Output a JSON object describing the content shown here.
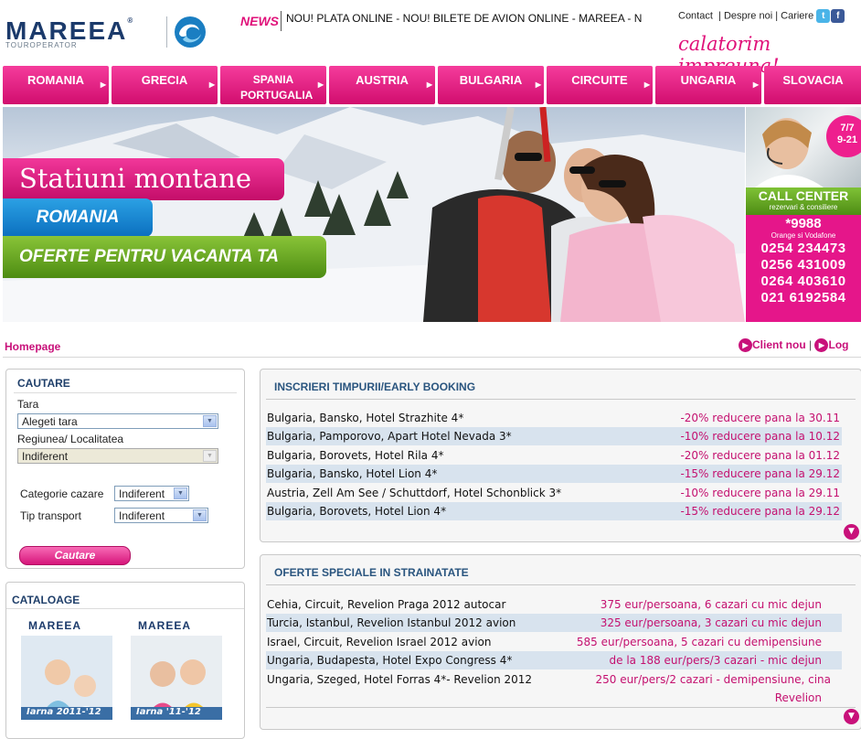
{
  "header": {
    "logo_text": "MAREEA",
    "logo_sub": "TOUROPERATOR",
    "news_label": "NEWS",
    "news_ticker": "NOU! PLATA ONLINE - NOU! BILETE DE AVION ONLINE - MAREEA - N",
    "links": [
      "Contact",
      "Despre noi",
      "Cariere"
    ],
    "tagline": "calatorim impreuna!"
  },
  "nav": [
    {
      "label": "ROMANIA"
    },
    {
      "label": "GRECIA"
    },
    {
      "label": "SPANIA PORTUGALIA"
    },
    {
      "label": "AUSTRIA"
    },
    {
      "label": "BULGARIA"
    },
    {
      "label": "CIRCUITE"
    },
    {
      "label": "UNGARIA"
    },
    {
      "label": "SLOVACIA"
    }
  ],
  "banner": {
    "line1": "Statiuni montane",
    "line2": "ROMANIA",
    "line3": "OFERTE PENTRU VACANTA TA"
  },
  "call_center": {
    "badge_1": "7/7",
    "badge_2": "9-21",
    "title": "CALL CENTER",
    "subtitle": "rezervari & consiliere",
    "short_code": "*9988",
    "short_code_note": "Orange si Vodafone",
    "phones": [
      "0254 234473",
      "0256 431009",
      "0264 403610",
      "021 6192584"
    ]
  },
  "breadcrumb": {
    "home": "Homepage",
    "client": "Client nou",
    "login": "Log"
  },
  "search": {
    "title": "CAUTARE",
    "country_label": "Tara",
    "country_value": "Alegeti tara",
    "region_label": "Regiunea/ Localitatea",
    "region_value": "Indiferent",
    "category_label": "Categorie cazare",
    "category_value": "Indiferent",
    "transport_label": "Tip transport",
    "transport_value": "Indiferent",
    "button": "Cautare"
  },
  "catalog": {
    "title": "CATALOAGE",
    "brand": "MAREEA",
    "items": [
      {
        "caption": "Iarna 2011-'12"
      },
      {
        "caption": "Iarna '11-'12"
      }
    ]
  },
  "early_booking": {
    "title": "INSCRIERI TIMPURII/EARLY BOOKING",
    "rows": [
      {
        "name": "Bulgaria, Bansko, Hotel Strazhite 4*",
        "promo": "-20% reducere pana la 30.11"
      },
      {
        "name": "Bulgaria, Pamporovo, Apart Hotel Nevada 3*",
        "promo": "-10% reducere pana la 10.12"
      },
      {
        "name": "Bulgaria, Borovets, Hotel Rila 4*",
        "promo": "-20% reducere pana la 01.12"
      },
      {
        "name": "Bulgaria, Bansko, Hotel Lion 4*",
        "promo": "-15% reducere pana la 29.12"
      },
      {
        "name": "Austria, Zell Am See / Schuttdorf, Hotel Schonblick 3*",
        "promo": "-10% reducere pana la 29.11"
      },
      {
        "name": "Bulgaria, Borovets, Hotel Lion 4*",
        "promo": "-15% reducere pana la 29.12"
      }
    ]
  },
  "special_offers": {
    "title": "OFERTE SPECIALE IN STRAINATATE",
    "rows": [
      {
        "name": "Cehia, Circuit, Revelion Praga 2012 autocar",
        "promo": "375 eur/persoana, 6 cazari cu mic dejun"
      },
      {
        "name": "Turcia, Istanbul, Revelion Istanbul 2012 avion",
        "promo": "325 eur/persoana, 3 cazari cu mic dejun"
      },
      {
        "name": "Israel, Circuit, Revelion Israel 2012 avion",
        "promo": "585 eur/persoana, 5 cazari cu demipensiune"
      },
      {
        "name": "Ungaria, Budapesta, Hotel Expo Congress 4*",
        "promo": "de la 188 eur/pers/3 cazari - mic dejun"
      },
      {
        "name": "Ungaria, Szeged, Hotel Forras 4*- Revelion 2012",
        "promo": "250 eur/pers/2 cazari - demipensiune, cina",
        "promo_cont": "Revelion"
      }
    ]
  },
  "colors": {
    "brand_pink": "#e0117a",
    "brand_navy": "#1b3a6b",
    "row_alt": "#d8e3ee"
  }
}
